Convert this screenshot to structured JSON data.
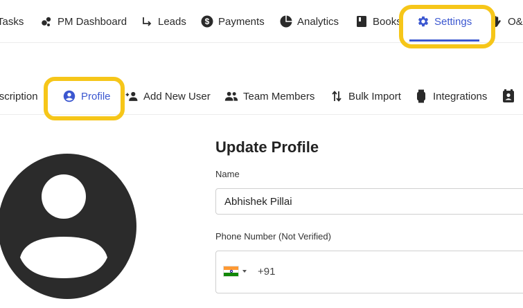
{
  "topnav": {
    "items": [
      {
        "label": "Tasks",
        "icon": "tasks-icon"
      },
      {
        "label": "PM Dashboard",
        "icon": "dashboard-icon"
      },
      {
        "label": "Leads",
        "icon": "leads-arrow-icon"
      },
      {
        "label": "Payments",
        "icon": "dollar-icon"
      },
      {
        "label": "Analytics",
        "icon": "pie-chart-icon"
      },
      {
        "label": "Books",
        "icon": "book-icon"
      },
      {
        "label": "Settings",
        "icon": "gear-icon",
        "active": true
      },
      {
        "label": "O&M",
        "icon": "hand-icon"
      }
    ]
  },
  "subnav": {
    "items": [
      {
        "label": "Subscription",
        "icon": ""
      },
      {
        "label": "Profile",
        "icon": "account-circle-icon",
        "active": true
      },
      {
        "label": "Add New User",
        "icon": "add-user-icon"
      },
      {
        "label": "Team Members",
        "icon": "group-icon"
      },
      {
        "label": "Bulk Import",
        "icon": "swap-vert-icon"
      },
      {
        "label": "Integrations",
        "icon": "watch-icon"
      },
      {
        "label": "",
        "icon": "contact-card-icon"
      }
    ]
  },
  "form": {
    "title": "Update Profile",
    "name_label": "Name",
    "name_value": "Abhishek Pillai",
    "phone_label": "Phone Number (Not Verified)",
    "country_flag": "india-flag-icon",
    "dial_code": "+91",
    "phone_value": ""
  },
  "colors": {
    "accent": "#3b57d0",
    "highlight": "#f6c619",
    "avatar": "#2b2b2b"
  }
}
